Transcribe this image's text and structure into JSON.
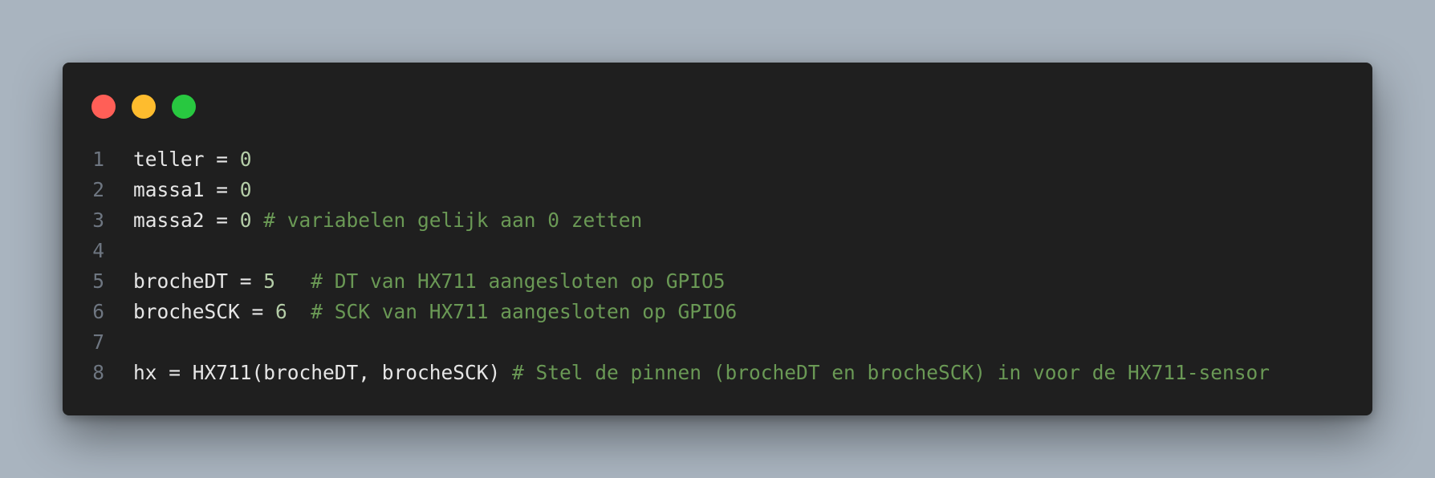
{
  "window_controls": {
    "close_color": "#ff5f57",
    "minimize_color": "#febc2e",
    "maximize_color": "#28c840"
  },
  "code_lines": [
    {
      "number": "1",
      "code": "teller = ",
      "value": "0",
      "comment": ""
    },
    {
      "number": "2",
      "code": "massa1 = ",
      "value": "0",
      "comment": ""
    },
    {
      "number": "3",
      "code": "massa2 = ",
      "value": "0",
      "comment": " # variabelen gelijk aan 0 zetten"
    },
    {
      "number": "4",
      "code": "",
      "value": "",
      "comment": ""
    },
    {
      "number": "5",
      "code": "brocheDT = ",
      "value": "5",
      "comment": "   # DT van HX711 aangesloten op GPIO5"
    },
    {
      "number": "6",
      "code": "brocheSCK = ",
      "value": "6",
      "comment": "  # SCK van HX711 aangesloten op GPIO6"
    },
    {
      "number": "7",
      "code": "",
      "value": "",
      "comment": ""
    },
    {
      "number": "8",
      "code": "hx = HX711(brocheDT, brocheSCK)",
      "value": "",
      "comment": " # Stel de pinnen (brocheDT en brocheSCK) in voor de HX711-sensor"
    }
  ]
}
